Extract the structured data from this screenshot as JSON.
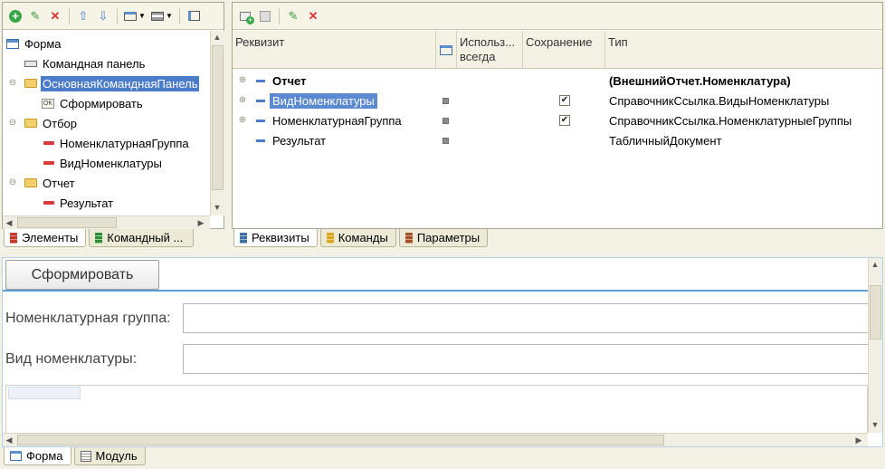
{
  "left_panel": {
    "toolbar": {
      "add_icon": "add-icon",
      "edit_icon": "pencil-icon",
      "delete_icon": "delete-icon",
      "up_icon": "arrow-up-icon",
      "down_icon": "arrow-down-icon",
      "layout_icon": "layout-icon",
      "panel_icon": "panel-icon",
      "preview_icon": "preview-icon"
    },
    "tree": [
      {
        "label": "Форма",
        "icon": "form-icon",
        "level": 0
      },
      {
        "label": "Командная панель",
        "icon": "command-panel-icon",
        "level": 1
      },
      {
        "label": "ОсновнаяКоманднаяПанель",
        "icon": "folder-icon",
        "level": 1,
        "selected": true
      },
      {
        "label": "Сформировать",
        "icon": "ok-button-icon",
        "level": 2
      },
      {
        "label": "Отбор",
        "icon": "folder-icon",
        "level": 1
      },
      {
        "label": "НоменклатурнаяГруппа",
        "icon": "field-icon",
        "level": 2
      },
      {
        "label": "ВидНоменклатуры",
        "icon": "field-icon",
        "level": 2
      },
      {
        "label": "Отчет",
        "icon": "folder-icon",
        "level": 1
      },
      {
        "label": "Результат",
        "icon": "field-icon",
        "level": 2
      }
    ],
    "tabs": [
      {
        "label": "Элементы",
        "active": true
      },
      {
        "label": "Командный ..."
      }
    ]
  },
  "right_panel": {
    "toolbar": {
      "add_icon": "add-attribute-icon",
      "copy_icon": "copy-icon",
      "edit_icon": "pencil-icon",
      "delete_icon": "delete-icon"
    },
    "columns": {
      "attribute": "Реквизит",
      "use_always": "Использ... всегда",
      "save": "Сохранение",
      "type": "Тип"
    },
    "rows": [
      {
        "name": "Отчет",
        "bold": true,
        "expandable": true,
        "save": false,
        "save_shown": false,
        "type": "(ВнешнийОтчет.Номенклатура)"
      },
      {
        "name": "ВидНоменклатуры",
        "selected": true,
        "expandable": true,
        "save": true,
        "save_shown": true,
        "type": "СправочникСсылка.ВидыНоменклатуры"
      },
      {
        "name": "НоменклатурнаяГруппа",
        "expandable": true,
        "save": true,
        "save_shown": true,
        "type": "СправочникСсылка.НоменклатурныеГруппы"
      },
      {
        "name": "Результат",
        "expandable": false,
        "save": false,
        "save_shown": false,
        "type": "ТабличныйДокумент"
      }
    ],
    "tabs": [
      {
        "label": "Реквизиты",
        "active": true
      },
      {
        "label": "Команды"
      },
      {
        "label": "Параметры"
      }
    ]
  },
  "preview": {
    "button_label": "Сформировать",
    "field1_label": "Номенклатурная группа:",
    "field1_value": "",
    "field2_label": "Вид номенклатуры:",
    "field2_value": ""
  },
  "bottom_tabs": [
    {
      "label": "Форма",
      "active": true
    },
    {
      "label": "Модуль"
    }
  ]
}
